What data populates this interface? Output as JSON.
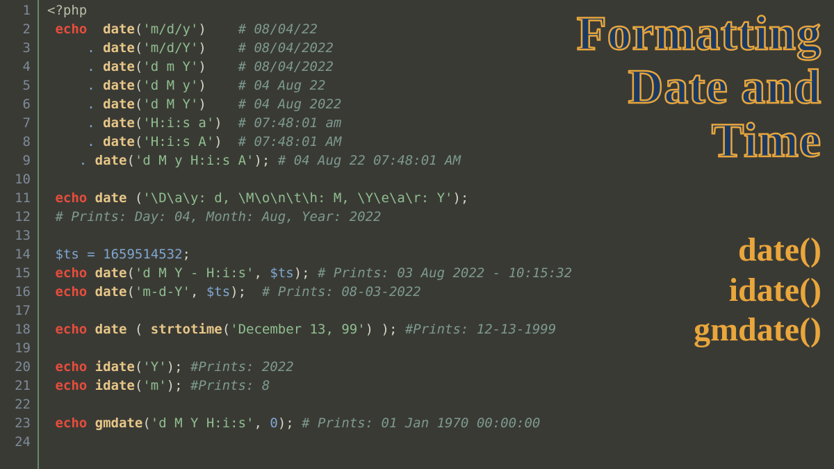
{
  "lines": [
    [
      {
        "c": "tok-phptag",
        "t": "<?php"
      }
    ],
    [
      {
        "c": "tok-punc",
        "t": " "
      },
      {
        "c": "tok-kw",
        "t": "echo"
      },
      {
        "c": "tok-punc",
        "t": "  "
      },
      {
        "c": "tok-fn",
        "t": "date"
      },
      {
        "c": "tok-punc",
        "t": "("
      },
      {
        "c": "tok-str",
        "t": "'m/d/y'"
      },
      {
        "c": "tok-punc",
        "t": ")    "
      },
      {
        "c": "tok-cmt",
        "t": "# 08/04/22"
      }
    ],
    [
      {
        "c": "tok-punc",
        "t": "     "
      },
      {
        "c": "tok-oph",
        "t": "."
      },
      {
        "c": "tok-punc",
        "t": " "
      },
      {
        "c": "tok-fn",
        "t": "date"
      },
      {
        "c": "tok-punc",
        "t": "("
      },
      {
        "c": "tok-str",
        "t": "'m/d/Y'"
      },
      {
        "c": "tok-punc",
        "t": ")    "
      },
      {
        "c": "tok-cmt",
        "t": "# 08/04/2022"
      }
    ],
    [
      {
        "c": "tok-punc",
        "t": "     "
      },
      {
        "c": "tok-oph",
        "t": "."
      },
      {
        "c": "tok-punc",
        "t": " "
      },
      {
        "c": "tok-fn",
        "t": "date"
      },
      {
        "c": "tok-punc",
        "t": "("
      },
      {
        "c": "tok-str",
        "t": "'d m Y'"
      },
      {
        "c": "tok-punc",
        "t": ")    "
      },
      {
        "c": "tok-cmt",
        "t": "# 08/04/2022"
      }
    ],
    [
      {
        "c": "tok-punc",
        "t": "     "
      },
      {
        "c": "tok-oph",
        "t": "."
      },
      {
        "c": "tok-punc",
        "t": " "
      },
      {
        "c": "tok-fn",
        "t": "date"
      },
      {
        "c": "tok-punc",
        "t": "("
      },
      {
        "c": "tok-str",
        "t": "'d M y'"
      },
      {
        "c": "tok-punc",
        "t": ")    "
      },
      {
        "c": "tok-cmt",
        "t": "# 04 Aug 22"
      }
    ],
    [
      {
        "c": "tok-punc",
        "t": "     "
      },
      {
        "c": "tok-oph",
        "t": "."
      },
      {
        "c": "tok-punc",
        "t": " "
      },
      {
        "c": "tok-fn",
        "t": "date"
      },
      {
        "c": "tok-punc",
        "t": "("
      },
      {
        "c": "tok-str",
        "t": "'d M Y'"
      },
      {
        "c": "tok-punc",
        "t": ")    "
      },
      {
        "c": "tok-cmt",
        "t": "# 04 Aug 2022"
      }
    ],
    [
      {
        "c": "tok-punc",
        "t": "     "
      },
      {
        "c": "tok-oph",
        "t": "."
      },
      {
        "c": "tok-punc",
        "t": " "
      },
      {
        "c": "tok-fn",
        "t": "date"
      },
      {
        "c": "tok-punc",
        "t": "("
      },
      {
        "c": "tok-str",
        "t": "'H:i:s a'"
      },
      {
        "c": "tok-punc",
        "t": ")  "
      },
      {
        "c": "tok-cmt",
        "t": "# 07:48:01 am"
      }
    ],
    [
      {
        "c": "tok-punc",
        "t": "     "
      },
      {
        "c": "tok-oph",
        "t": "."
      },
      {
        "c": "tok-punc",
        "t": " "
      },
      {
        "c": "tok-fn",
        "t": "date"
      },
      {
        "c": "tok-punc",
        "t": "("
      },
      {
        "c": "tok-str",
        "t": "'H:i:s A'"
      },
      {
        "c": "tok-punc",
        "t": ")  "
      },
      {
        "c": "tok-cmt",
        "t": "# 07:48:01 AM"
      }
    ],
    [
      {
        "c": "tok-punc",
        "t": "    "
      },
      {
        "c": "tok-oph",
        "t": "."
      },
      {
        "c": "tok-punc",
        "t": " "
      },
      {
        "c": "tok-fn",
        "t": "date"
      },
      {
        "c": "tok-punc",
        "t": "("
      },
      {
        "c": "tok-str",
        "t": "'d M y H:i:s A'"
      },
      {
        "c": "tok-punc",
        "t": "); "
      },
      {
        "c": "tok-cmt",
        "t": "# 04 Aug 22 07:48:01 AM"
      }
    ],
    [
      {
        "c": "tok-punc",
        "t": ""
      }
    ],
    [
      {
        "c": "tok-punc",
        "t": " "
      },
      {
        "c": "tok-kw",
        "t": "echo"
      },
      {
        "c": "tok-punc",
        "t": " "
      },
      {
        "c": "tok-fn",
        "t": "date"
      },
      {
        "c": "tok-punc",
        "t": " ("
      },
      {
        "c": "tok-str",
        "t": "'\\D\\a\\y: d, \\M\\o\\n\\t\\h: M, \\Y\\e\\a\\r: Y'"
      },
      {
        "c": "tok-punc",
        "t": ");"
      }
    ],
    [
      {
        "c": "tok-punc",
        "t": " "
      },
      {
        "c": "tok-cmt",
        "t": "# Prints: Day: 04, Month: Aug, Year: 2022"
      }
    ],
    [
      {
        "c": "tok-punc",
        "t": ""
      }
    ],
    [
      {
        "c": "tok-punc",
        "t": " "
      },
      {
        "c": "tok-var",
        "t": "$ts"
      },
      {
        "c": "tok-punc",
        "t": " "
      },
      {
        "c": "tok-oph",
        "t": "="
      },
      {
        "c": "tok-punc",
        "t": " "
      },
      {
        "c": "tok-num",
        "t": "1659514532"
      },
      {
        "c": "tok-punc",
        "t": ";"
      }
    ],
    [
      {
        "c": "tok-punc",
        "t": " "
      },
      {
        "c": "tok-kw",
        "t": "echo"
      },
      {
        "c": "tok-punc",
        "t": " "
      },
      {
        "c": "tok-fn",
        "t": "date"
      },
      {
        "c": "tok-punc",
        "t": "("
      },
      {
        "c": "tok-str",
        "t": "'d M Y - H:i:s'"
      },
      {
        "c": "tok-punc",
        "t": ", "
      },
      {
        "c": "tok-var",
        "t": "$ts"
      },
      {
        "c": "tok-punc",
        "t": "); "
      },
      {
        "c": "tok-cmt",
        "t": "# Prints: 03 Aug 2022 - 10:15:32"
      }
    ],
    [
      {
        "c": "tok-punc",
        "t": " "
      },
      {
        "c": "tok-kw",
        "t": "echo"
      },
      {
        "c": "tok-punc",
        "t": " "
      },
      {
        "c": "tok-fn",
        "t": "date"
      },
      {
        "c": "tok-punc",
        "t": "("
      },
      {
        "c": "tok-str",
        "t": "'m-d-Y'"
      },
      {
        "c": "tok-punc",
        "t": ", "
      },
      {
        "c": "tok-var",
        "t": "$ts"
      },
      {
        "c": "tok-punc",
        "t": ");  "
      },
      {
        "c": "tok-cmt",
        "t": "# Prints: 08-03-2022"
      }
    ],
    [
      {
        "c": "tok-punc",
        "t": ""
      }
    ],
    [
      {
        "c": "tok-punc",
        "t": " "
      },
      {
        "c": "tok-kw",
        "t": "echo"
      },
      {
        "c": "tok-punc",
        "t": " "
      },
      {
        "c": "tok-fn",
        "t": "date"
      },
      {
        "c": "tok-punc",
        "t": " ( "
      },
      {
        "c": "tok-fn",
        "t": "strtotime"
      },
      {
        "c": "tok-punc",
        "t": "("
      },
      {
        "c": "tok-str",
        "t": "'December 13, 99'"
      },
      {
        "c": "tok-punc",
        "t": ") ); "
      },
      {
        "c": "tok-cmt",
        "t": "#Prints: 12-13-1999"
      }
    ],
    [
      {
        "c": "tok-punc",
        "t": ""
      }
    ],
    [
      {
        "c": "tok-punc",
        "t": " "
      },
      {
        "c": "tok-kw",
        "t": "echo"
      },
      {
        "c": "tok-punc",
        "t": " "
      },
      {
        "c": "tok-fn",
        "t": "idate"
      },
      {
        "c": "tok-punc",
        "t": "("
      },
      {
        "c": "tok-str",
        "t": "'Y'"
      },
      {
        "c": "tok-punc",
        "t": "); "
      },
      {
        "c": "tok-cmt",
        "t": "#Prints: 2022"
      }
    ],
    [
      {
        "c": "tok-punc",
        "t": " "
      },
      {
        "c": "tok-kw",
        "t": "echo"
      },
      {
        "c": "tok-punc",
        "t": " "
      },
      {
        "c": "tok-fn",
        "t": "idate"
      },
      {
        "c": "tok-punc",
        "t": "("
      },
      {
        "c": "tok-str",
        "t": "'m'"
      },
      {
        "c": "tok-punc",
        "t": "); "
      },
      {
        "c": "tok-cmt",
        "t": "#Prints: 8"
      }
    ],
    [
      {
        "c": "tok-punc",
        "t": ""
      }
    ],
    [
      {
        "c": "tok-punc",
        "t": " "
      },
      {
        "c": "tok-kw",
        "t": "echo"
      },
      {
        "c": "tok-punc",
        "t": " "
      },
      {
        "c": "tok-fn",
        "t": "gmdate"
      },
      {
        "c": "tok-punc",
        "t": "("
      },
      {
        "c": "tok-str",
        "t": "'d M Y H:i:s'"
      },
      {
        "c": "tok-punc",
        "t": ", "
      },
      {
        "c": "tok-num",
        "t": "0"
      },
      {
        "c": "tok-punc",
        "t": "); "
      },
      {
        "c": "tok-cmt",
        "t": "# Prints: 01 Jan 1970 00:00:00"
      }
    ],
    [
      {
        "c": "tok-punc",
        "t": ""
      }
    ]
  ],
  "title_lines": [
    "Formatting",
    "Date and",
    "Time"
  ],
  "fn_list": [
    "date()",
    "idate()",
    "gmdate()"
  ]
}
